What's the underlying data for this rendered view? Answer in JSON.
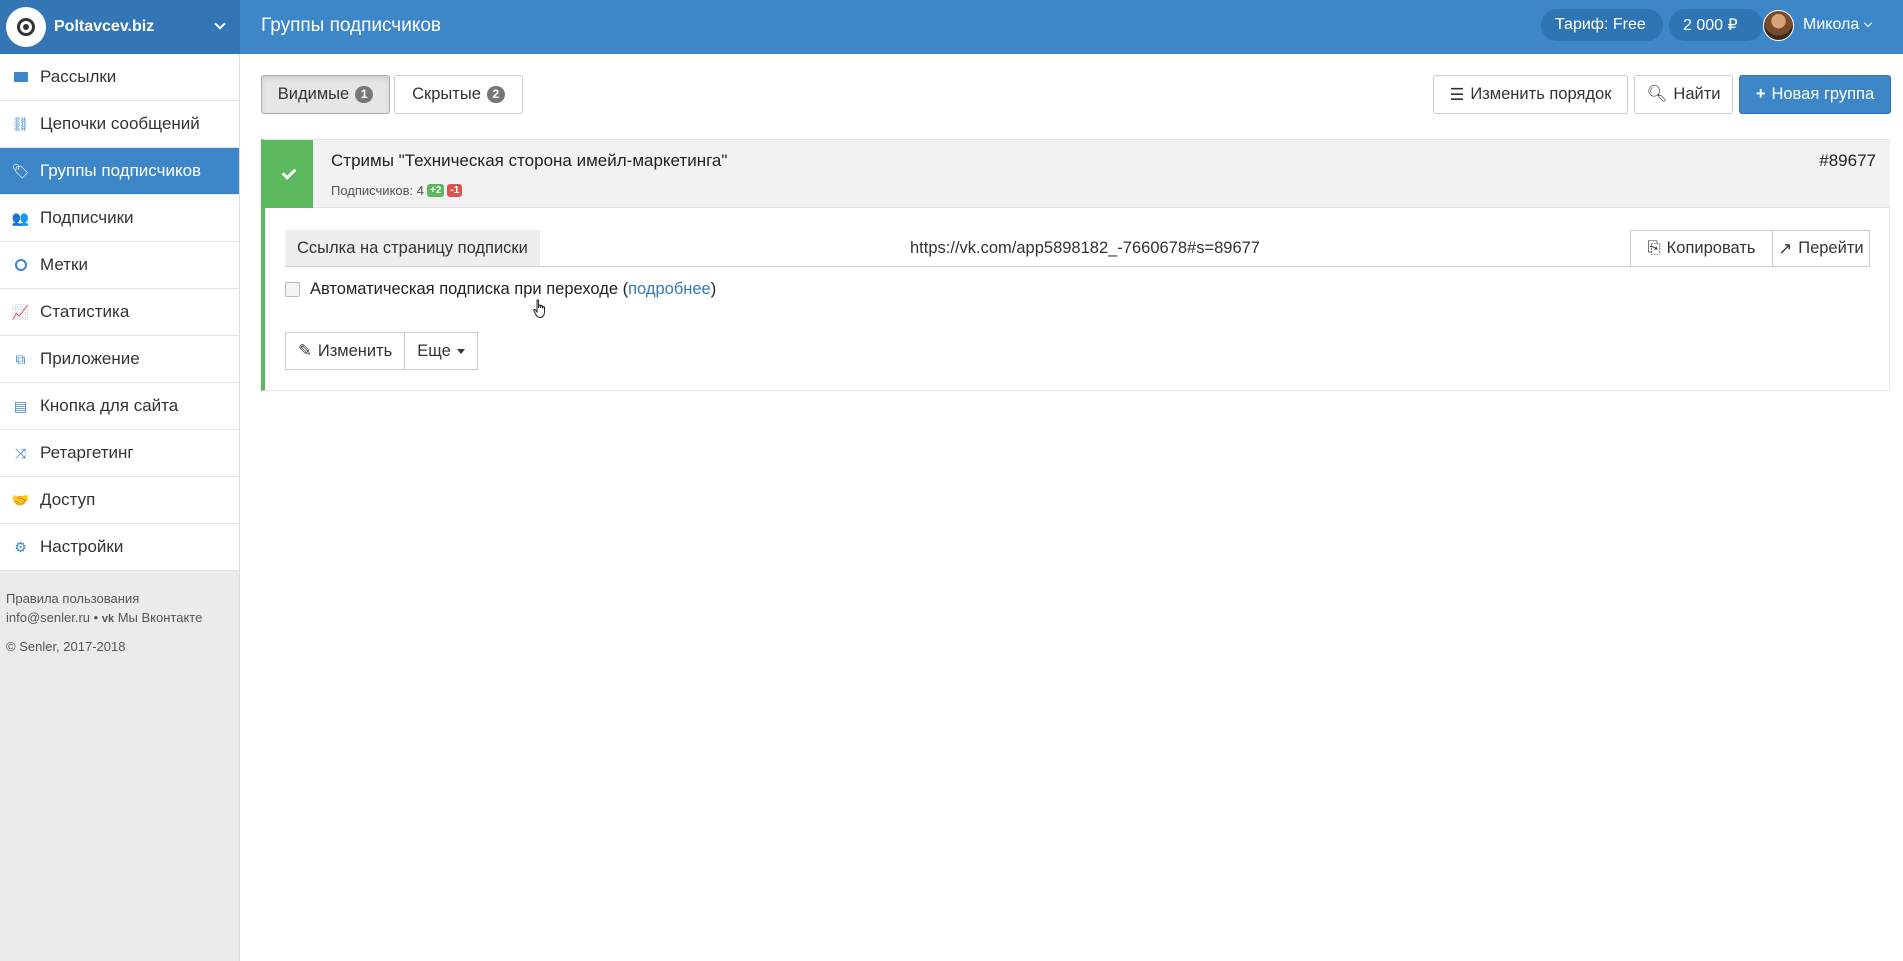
{
  "header": {
    "brand": "Poltavcev.biz",
    "page_title": "Группы подписчиков",
    "tariff": "Тариф: Free",
    "balance": "2 000 ₽",
    "user_name": "Микола"
  },
  "sidebar": {
    "items": [
      {
        "label": "Рассылки",
        "icon": "envelope-icon"
      },
      {
        "label": "Цепочки сообщений",
        "icon": "chain-icon"
      },
      {
        "label": "Группы подписчиков",
        "icon": "tags-icon",
        "active": true
      },
      {
        "label": "Подписчики",
        "icon": "users-icon"
      },
      {
        "label": "Метки",
        "icon": "circle-icon"
      },
      {
        "label": "Статистика",
        "icon": "line-chart-icon"
      },
      {
        "label": "Приложение",
        "icon": "cubes-icon"
      },
      {
        "label": "Кнопка для сайта",
        "icon": "code-file-icon"
      },
      {
        "label": "Ретаргетинг",
        "icon": "shuffle-icon"
      },
      {
        "label": "Доступ",
        "icon": "handshake-icon"
      },
      {
        "label": "Настройки",
        "icon": "cogs-icon"
      }
    ],
    "footer": {
      "terms": "Правила пользования",
      "email": "info@senler.ru",
      "vk": "Мы Вконтакте",
      "copyright": "© Senler, 2017-2018"
    }
  },
  "toolbar": {
    "tab_visible": "Видимые",
    "tab_visible_count": "1",
    "tab_hidden": "Скрытые",
    "tab_hidden_count": "2",
    "reorder": "Изменить порядок",
    "find": "Найти",
    "new_group": "Новая группа"
  },
  "group": {
    "title": "Стримы \"Техническая сторона имейл-маркетинга\"",
    "id": "#89677",
    "subscribers_label": "Подписчиков: 4",
    "plus": "+2",
    "minus": "-1",
    "link_label": "Ссылка на страницу подписки",
    "link_url": "https://vk.com/app5898182_-7660678#s=89677",
    "copy": "Копировать",
    "go": "Перейти",
    "auto_text": "Автоматическая подписка при переходе (",
    "auto_link": "подробнее",
    "auto_close": ")",
    "edit": "Изменить",
    "more": "Еще"
  },
  "colors": {
    "brand_blue": "#3d87c9",
    "success_green": "#5cb85c",
    "danger_red": "#d9534f"
  }
}
